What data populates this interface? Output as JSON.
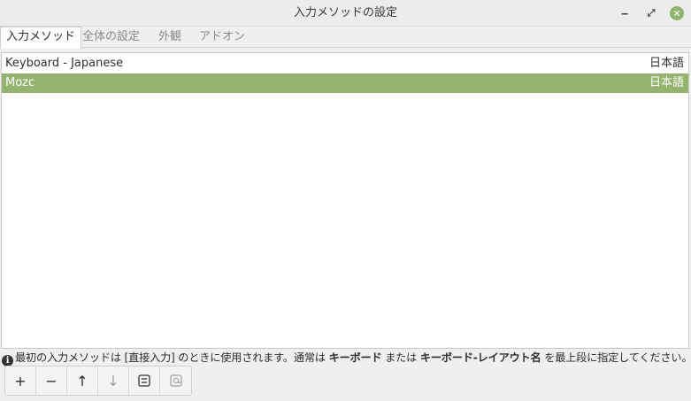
{
  "window": {
    "title": "入力メソッドの設定",
    "minimize_glyph": "‒",
    "maximize_glyph": "⤢",
    "close_glyph": "✕"
  },
  "tabs": [
    {
      "label": "入力メソッド",
      "active": true
    },
    {
      "label": "全体の設定",
      "active": false
    },
    {
      "label": "外観",
      "active": false
    },
    {
      "label": "アドオン",
      "active": false
    }
  ],
  "input_methods": [
    {
      "name": "Keyboard - Japanese",
      "language": "日本語",
      "selected": false
    },
    {
      "name": "Mozc",
      "language": "日本語",
      "selected": true
    }
  ],
  "info": {
    "icon": "info-icon",
    "icon_glyph": "i",
    "part1": "最初の入力メソッドは [直接入力] のときに使用されます。通常は ",
    "bold1": "キーボード",
    "part2": " または ",
    "bold2": "キーボード-レイアウト名",
    "part3": " を最上段に指定してください。"
  },
  "toolbar": {
    "add": "+",
    "remove": "−",
    "up": "↑",
    "down": "↓",
    "configure_icon": "configure-icon",
    "keyboard_icon": "keyboard-layout-icon"
  },
  "colors": {
    "selection": "#94b36f",
    "close_button": "#8fb36e"
  }
}
